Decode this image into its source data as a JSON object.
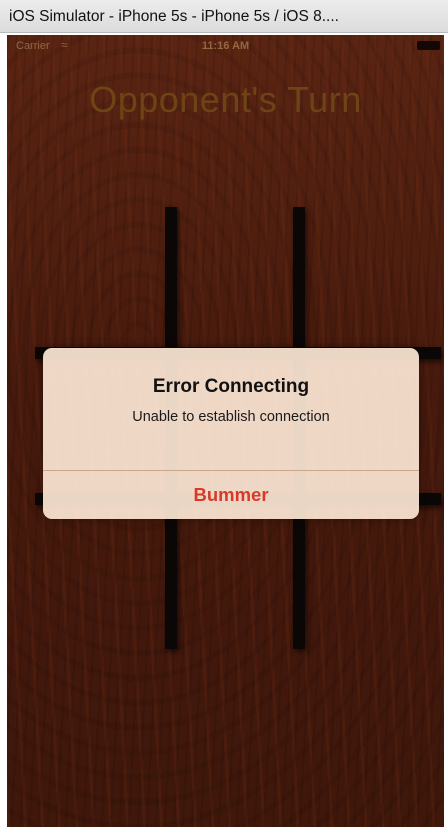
{
  "window": {
    "title": "iOS Simulator - iPhone 5s - iPhone 5s / iOS 8...."
  },
  "statusbar": {
    "carrier": "Carrier",
    "wifi_icon": "wifi-icon",
    "time": "11:16 AM",
    "battery_icon": "battery-icon"
  },
  "game": {
    "turn_label": "Opponent's Turn"
  },
  "alert": {
    "title": "Error Connecting",
    "message": "Unable to establish connection",
    "button_label": "Bummer"
  },
  "colors": {
    "wood_background": "#4a1d10",
    "turn_text": "#6e4416",
    "alert_button": "#d83a2a",
    "grid_bars": "#0b0706"
  }
}
